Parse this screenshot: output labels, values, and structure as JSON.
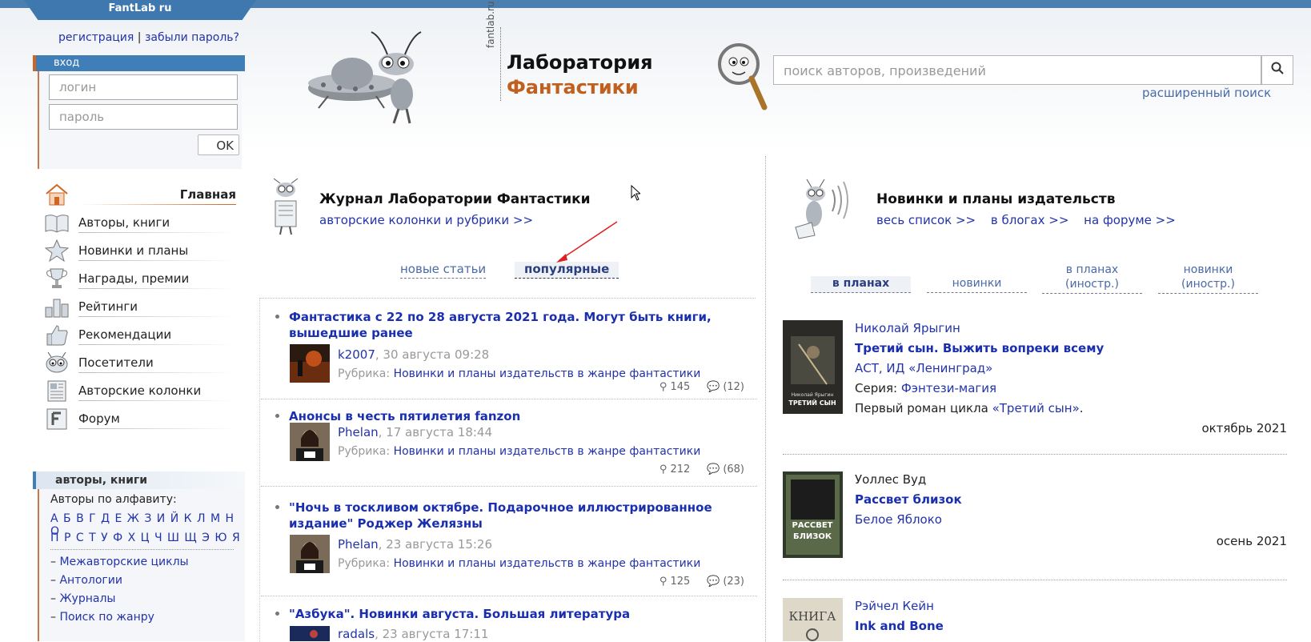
{
  "site": {
    "tab": "FantLab ru",
    "brand_line1": "Лаборатория",
    "brand_line2": "Фантастики",
    "vertical": "fantlab.ru"
  },
  "auth": {
    "register": "регистрация",
    "sep": "|",
    "forgot": "забыли пароль?",
    "header": "вход",
    "login_placeholder": "логин",
    "password_placeholder": "пароль",
    "ok": "OK"
  },
  "search": {
    "placeholder": "поиск авторов, произведений",
    "advanced": "расширенный поиск"
  },
  "nav": [
    {
      "label": "Главная"
    },
    {
      "label": "Авторы, книги"
    },
    {
      "label": "Новинки и планы"
    },
    {
      "label": "Награды, премии"
    },
    {
      "label": "Рейтинги"
    },
    {
      "label": "Рекомендации"
    },
    {
      "label": "Посетители"
    },
    {
      "label": "Авторские колонки"
    },
    {
      "label": "Форум"
    }
  ],
  "authors_box": {
    "header": "авторы, книги",
    "alpha_title": "Авторы по алфавиту:",
    "row1": "А Б В Г Д Е Ж З И Й К Л М Н О",
    "row2": "П Р С Т У Ф Х Ц Ч Ш Щ Э Ю Я",
    "links": [
      "Межавторские циклы",
      "Антологии",
      "Журналы",
      "Поиск по жанру"
    ],
    "dash": "–"
  },
  "journal": {
    "title": "Журнал Лаборатории Фантастики",
    "subtitle": "авторские колонки и рубрики >>",
    "tab_new": "новые статьи",
    "tab_popular": "популярные",
    "articles": [
      {
        "title": "Фантастика с 22 по 28 августа 2021 года. Могут быть книги, вышедшие ранее",
        "user": "k2007",
        "date": ", 30 августа 09:28",
        "rubric_label": "Рубрика: ",
        "rubric": "Новинки и планы издательств в жанре фантастики",
        "views": "145",
        "comments": "(12)"
      },
      {
        "title": "Анонсы в честь пятилетия fanzon",
        "user": "Phelan",
        "date": ", 17 августа 18:44",
        "rubric_label": "Рубрика: ",
        "rubric": "Новинки и планы издательств в жанре фантастики",
        "views": "212",
        "comments": "(68)"
      },
      {
        "title": "\"Ночь в тоскливом октябре. Подарочное иллюстрированное издание\" Роджер Желязны",
        "user": "Phelan",
        "date": ", 23 августа 15:26",
        "rubric_label": "Рубрика: ",
        "rubric": "Новинки и планы издательств в жанре фантастики",
        "views": "125",
        "comments": "(23)"
      },
      {
        "title": "\"Азбука\". Новинки августа. Большая литература",
        "user": "radals",
        "date": ", 23 августа 17:11"
      }
    ]
  },
  "news": {
    "title": "Новинки и планы издательств",
    "link_all": "весь список >>",
    "link_blogs": "в блогах >>",
    "link_forum": "на форуме >>",
    "tabs": [
      "в планах",
      "новинки",
      "в планах (иностр.)",
      "новинки (иностр.)"
    ],
    "books": [
      {
        "author": "Николай Ярыгин",
        "title": "Третий сын. Выжить вопреки всему",
        "publisher": "АСТ, ИД «Ленинград»",
        "series_label": "Серия: ",
        "series": "Фэнтези-магия",
        "note_pre": "Первый роман цикла ",
        "note_link": "«Третий сын»",
        "note_post": ".",
        "date": "октябрь 2021",
        "cover_text": "ТРЕТИЙ СЫН",
        "cover_author": "Николай Ярыгин"
      },
      {
        "author": "Уоллес Вуд",
        "title": "Рассвет близок",
        "publisher": "Белое Яблоко",
        "date": "осень 2021",
        "cover_text": "РАССВЕТ БЛИЗОК"
      },
      {
        "author": "Рэйчел Кейн",
        "title": "Ink and Bone",
        "cover_text": "КНИГА"
      }
    ]
  },
  "colors": {
    "accent": "#3f7eb6",
    "orange": "#c1601e",
    "link": "#2233aa"
  }
}
